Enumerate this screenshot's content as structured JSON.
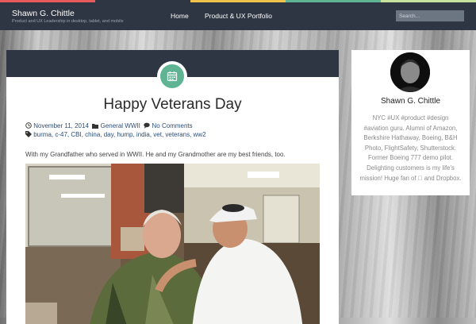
{
  "accent_colors": [
    "#e85a5a",
    "#2d3642",
    "#f1c24b",
    "#5fb494",
    "#c8e3a0"
  ],
  "header": {
    "site_title": "Shawn G. Chittle",
    "tagline": "Product and UX Leadership in desktop, tablet, and mobile",
    "nav": [
      {
        "label": "Home"
      },
      {
        "label": "Product & UX Portfolio"
      }
    ],
    "search_placeholder": "Search..."
  },
  "post": {
    "title": "Happy Veterans Day",
    "date": "November 11, 2014",
    "category": "General WWII",
    "comments": "No Comments",
    "tags": "burma, c-47, CBI, china, day, hump, india, vet, veterans, ww2",
    "excerpt": "With my Grandfather who served in WWII. He and my Grandmother are my best friends, too.",
    "badge_icon": "calendar-icon",
    "badge_color": "#5fb494"
  },
  "sidebar": {
    "name": "Shawn G. Chittle",
    "bio": "NYC #UX #product #design #aviation guru. Alumni of Amazon, Berkshire Hathaway, Boeing, B&H Photo, FlightSafety, Shutterstock. Former Boeing 777 demo pilot. Delighting customers is my life's mission! Huge fan of  and Dropbox."
  }
}
